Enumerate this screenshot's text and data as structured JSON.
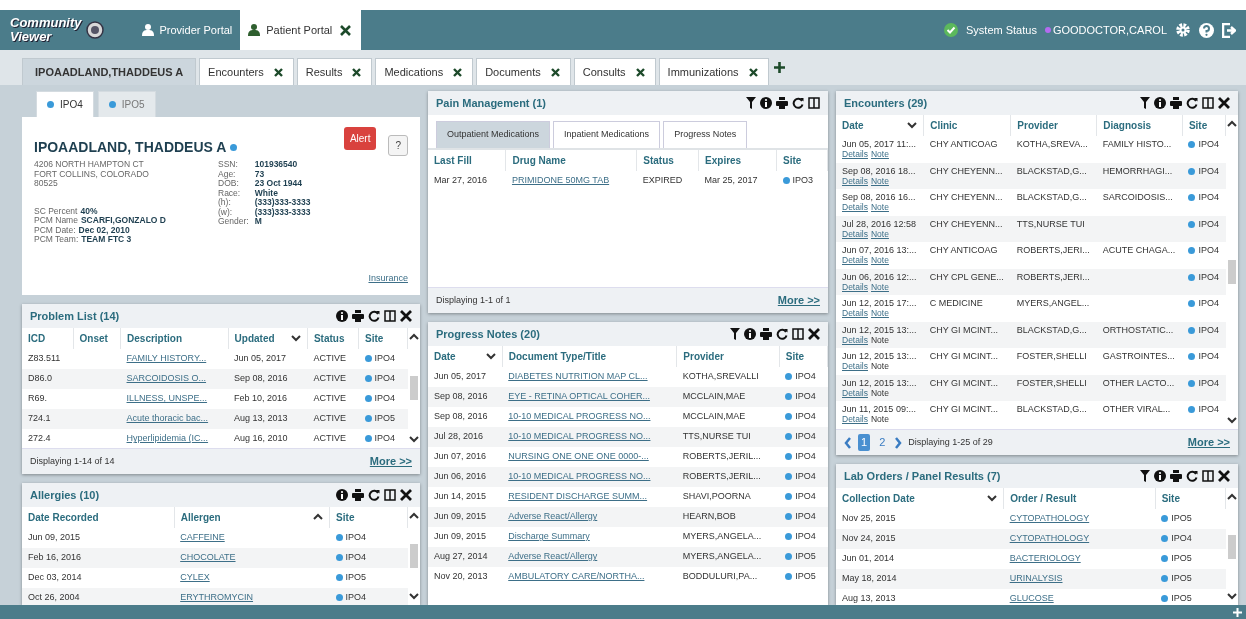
{
  "header": {
    "logo": {
      "line1": "Community",
      "line2": "Viewer"
    },
    "portal_tabs": [
      {
        "label": "Provider Portal",
        "selected": false,
        "closable": false
      },
      {
        "label": "Patient Portal",
        "selected": true,
        "closable": true
      }
    ],
    "system_status": "System Status",
    "user": {
      "name": "GOODOCTOR,CAROL",
      "color": "#b36bf0"
    }
  },
  "tabs": [
    {
      "label": "IPOAADLAND,THADDEUS A",
      "selected": true,
      "closable": false
    },
    {
      "label": "Encounters",
      "selected": false,
      "closable": true
    },
    {
      "label": "Results",
      "selected": false,
      "closable": true
    },
    {
      "label": "Medications",
      "selected": false,
      "closable": true
    },
    {
      "label": "Documents",
      "selected": false,
      "closable": true
    },
    {
      "label": "Consults",
      "selected": false,
      "closable": true
    },
    {
      "label": "Immunizations",
      "selected": false,
      "closable": true
    }
  ],
  "patient_card": {
    "site_tabs": [
      {
        "label": "IPO4",
        "selected": true
      },
      {
        "label": "IPO5",
        "selected": false
      }
    ],
    "name": "IPOAADLAND, THADDEUS A",
    "alert": "Alert",
    "help": "?",
    "address": [
      "4206 NORTH HAMPTON CT",
      "FORT COLLINS, COLORADO",
      "80525"
    ],
    "left_fields": [
      {
        "label": "SC Percent",
        "value": "40%"
      },
      {
        "label": "PCM Name",
        "value": "SCARFI,GONZALO D"
      },
      {
        "label": "PCM Date:",
        "value": "Dec 02, 2010"
      },
      {
        "label": "PCM Team:",
        "value": "TEAM FTC 3"
      }
    ],
    "right_fields": [
      {
        "label": "SSN:",
        "value": "101936540"
      },
      {
        "label": "Age:",
        "value": "73"
      },
      {
        "label": "DOB:",
        "value": "23 Oct 1944"
      },
      {
        "label": "Race:",
        "value": "White"
      },
      {
        "label": "(h):",
        "value": "(333)333-3333"
      },
      {
        "label": "(w):",
        "value": "(333)333-3333"
      },
      {
        "label": "Gender:",
        "value": "M"
      }
    ],
    "insurance_link": "Insurance"
  },
  "problem_list": {
    "title": "Problem List (14)",
    "tools": [
      {
        "kind": "info"
      },
      {
        "kind": "print"
      },
      {
        "kind": "refresh"
      },
      {
        "kind": "columns"
      },
      {
        "kind": "close"
      }
    ],
    "scrollable": true,
    "columns": [
      {
        "label": "ICD",
        "kind": "text"
      },
      {
        "label": "Onset",
        "kind": "text"
      },
      {
        "label": "Description",
        "kind": "link"
      },
      {
        "label": "Updated",
        "kind": "text",
        "sort_icon": {
          "kind": "down"
        }
      },
      {
        "label": "Status",
        "kind": "text"
      },
      {
        "label": "Site",
        "kind": "site"
      }
    ],
    "rows": [
      [
        "Z83.511",
        null,
        "FAMILY HISTORY...",
        "Jun 05, 2017",
        "ACTIVE",
        "IPO4"
      ],
      [
        "D86.0",
        null,
        "SARCOIDOSIS O...",
        "Sep 08, 2016",
        "ACTIVE",
        "IPO4"
      ],
      [
        "R69.",
        null,
        "ILLNESS, UNSPE...",
        "Feb 10, 2016",
        "ACTIVE",
        "IPO4"
      ],
      [
        "724.1",
        null,
        "Acute thoracic bac...",
        "Aug 13, 2013",
        "ACTIVE",
        "IPO5"
      ],
      [
        "272.4",
        null,
        "Hyperlipidemia (IC...",
        "Aug 16, 2010",
        "ACTIVE",
        "IPO4"
      ]
    ],
    "footer": {
      "text": "Displaying 1-14 of 14",
      "more": "More >>"
    }
  },
  "allergies": {
    "title": "Allergies (10)",
    "tools": [
      {
        "kind": "info"
      },
      {
        "kind": "print"
      },
      {
        "kind": "refresh"
      },
      {
        "kind": "columns"
      },
      {
        "kind": "close"
      }
    ],
    "scrollable": true,
    "columns": [
      {
        "label": "Date Recorded",
        "kind": "text"
      },
      {
        "label": "Allergen",
        "kind": "link",
        "sort_icon": {
          "kind": "up"
        }
      },
      {
        "label": "Site",
        "kind": "site"
      }
    ],
    "rows": [
      [
        "Jun 09, 2015",
        "CAFFEINE",
        "IPO4"
      ],
      [
        "Feb 16, 2016",
        "CHOCOLATE",
        "IPO4"
      ],
      [
        "Dec 03, 2014",
        "CYLEX",
        "IPO5"
      ],
      [
        "Oct 26, 2004",
        "ERYTHROMYCIN",
        "IPO4"
      ]
    ]
  },
  "pain_management": {
    "title": "Pain Management (1)",
    "tools": [
      {
        "kind": "filter"
      },
      {
        "kind": "info"
      },
      {
        "kind": "print"
      },
      {
        "kind": "refresh"
      },
      {
        "kind": "columns"
      }
    ],
    "tabs": [
      {
        "label": "Outpatient Medications",
        "selected": true
      },
      {
        "label": "Inpatient Medications",
        "selected": false
      },
      {
        "label": "Progress Notes",
        "selected": false
      }
    ],
    "columns": [
      {
        "label": "Last Fill",
        "kind": "text"
      },
      {
        "label": "Drug Name",
        "kind": "link"
      },
      {
        "label": "Status",
        "kind": "text"
      },
      {
        "label": "Expires",
        "kind": "text"
      },
      {
        "label": "Site",
        "kind": "site"
      }
    ],
    "rows": [
      [
        "Mar 27, 2016",
        "PRIMIDONE 50MG TAB",
        "EXPIRED",
        "Mar 25, 2017",
        "IPO3"
      ]
    ],
    "footer": {
      "text": "Displaying 1-1 of 1",
      "more": "More >>"
    }
  },
  "progress_notes": {
    "title": "Progress Notes (20)",
    "tools": [
      {
        "kind": "filter"
      },
      {
        "kind": "info"
      },
      {
        "kind": "print"
      },
      {
        "kind": "refresh"
      },
      {
        "kind": "columns"
      },
      {
        "kind": "close"
      }
    ],
    "columns": [
      {
        "label": "Date",
        "kind": "text",
        "sort_icon": {
          "kind": "down"
        }
      },
      {
        "label": "Document Type/Title",
        "kind": "link"
      },
      {
        "label": "Provider",
        "kind": "text"
      },
      {
        "label": "Site",
        "kind": "site"
      }
    ],
    "rows": [
      [
        "Jun 05, 2017",
        "DIABETES NUTRITION MAP CL...",
        "KOTHA,SREVALLI",
        "IPO4"
      ],
      [
        "Sep 08, 2016",
        "EYE - RETINA OPTICAL COHER...",
        "MCCLAIN,MAE",
        "IPO4"
      ],
      [
        "Sep 08, 2016",
        "10-10 MEDICAL PROGRESS NO...",
        "MCCLAIN,MAE",
        "IPO4"
      ],
      [
        "Jul 28, 2016",
        "10-10 MEDICAL PROGRESS NO...",
        "TTS,NURSE TUI",
        "IPO4"
      ],
      [
        "Jun 07, 2016",
        "NURSING ONE ONE ONE 0000-...",
        "ROBERTS,JERIL...",
        "IPO4"
      ],
      [
        "Jun 06, 2016",
        "10-10 MEDICAL PROGRESS NO...",
        "ROBERTS,JERIL...",
        "IPO4"
      ],
      [
        "Jun 14, 2015",
        "RESIDENT DISCHARGE SUMM...",
        "SHAVI,POORNA",
        "IPO4"
      ],
      [
        "Jun 09, 2015",
        "Adverse React/Allergy",
        "HEARN,BOB",
        "IPO4"
      ],
      [
        "Jun 09, 2015",
        "Discharge Summary",
        "MYERS,ANGELA...",
        "IPO4"
      ],
      [
        "Aug 27, 2014",
        "Adverse React/Allergy",
        "MYERS,ANGELA...",
        "IPO5"
      ],
      [
        "Nov 20, 2013",
        "AMBULATORY CARE/NORTHA...",
        "BODDULURI,PA...",
        "IPO5"
      ]
    ]
  },
  "encounters": {
    "title": "Encounters (29)",
    "tools": [
      {
        "kind": "filter"
      },
      {
        "kind": "info"
      },
      {
        "kind": "print"
      },
      {
        "kind": "refresh"
      },
      {
        "kind": "columns"
      },
      {
        "kind": "close"
      }
    ],
    "scrollable": true,
    "columns": [
      {
        "label": "Date",
        "kind": "encounter",
        "sort_icon": {
          "kind": "down"
        }
      },
      {
        "label": "Clinic",
        "kind": "text"
      },
      {
        "label": "Provider",
        "kind": "text"
      },
      {
        "label": "Diagnosis",
        "kind": "text"
      },
      {
        "label": "Site",
        "kind": "site"
      }
    ],
    "rows": [
      {
        "cells": [
          "Jun 05, 2017 11:...",
          "CHY ANTICOAG",
          "KOTHA,SREVA...",
          "FAMILY HISTO...",
          "IPO4"
        ],
        "links": [
          {
            "label": "Details",
            "linked": true
          },
          {
            "label": "Note",
            "linked": true
          }
        ]
      },
      {
        "cells": [
          "Sep 08, 2016 18...",
          "CHY CHEYENN...",
          "BLACKSTAD,G...",
          "HEMORRHAGI...",
          "IPO4"
        ],
        "links": [
          {
            "label": "Details",
            "linked": true
          },
          {
            "label": "Note",
            "linked": true
          }
        ]
      },
      {
        "cells": [
          "Sep 08, 2016 16...",
          "CHY CHEYENN...",
          "BLACKSTAD,G...",
          "SARCOIDOSIS...",
          "IPO4"
        ],
        "links": [
          {
            "label": "Details",
            "linked": true
          },
          {
            "label": "Note",
            "linked": true
          }
        ]
      },
      {
        "cells": [
          "Jul 28, 2016 12:58",
          "CHY CHEYENN...",
          "TTS,NURSE TUI",
          null,
          "IPO4"
        ],
        "links": [
          {
            "label": "Details",
            "linked": true
          },
          {
            "label": "Note",
            "linked": true
          }
        ]
      },
      {
        "cells": [
          "Jun 07, 2016 13:...",
          "CHY ANTICOAG",
          "ROBERTS,JERI...",
          "ACUTE CHAGA...",
          "IPO4"
        ],
        "links": [
          {
            "label": "Details",
            "linked": true
          },
          {
            "label": "Note",
            "linked": true
          }
        ]
      },
      {
        "cells": [
          "Jun 06, 2016 12:...",
          "CHY CPL GENE...",
          "ROBERTS,JERI...",
          null,
          "IPO4"
        ],
        "links": [
          {
            "label": "Details",
            "linked": true
          },
          {
            "label": "Note",
            "linked": true
          }
        ]
      },
      {
        "cells": [
          "Jun 12, 2015 17:...",
          "C MEDICINE",
          "MYERS,ANGEL...",
          null,
          "IPO4"
        ],
        "links": [
          {
            "label": "Details",
            "linked": true
          },
          {
            "label": "Note",
            "linked": true
          }
        ]
      },
      {
        "cells": [
          "Jun 12, 2015 13:...",
          "CHY GI MCINT...",
          "BLACKSTAD,G...",
          "ORTHOSTATIC...",
          "IPO4"
        ],
        "links": [
          {
            "label": "Details",
            "linked": true
          },
          {
            "label": "Note",
            "linked": false
          }
        ]
      },
      {
        "cells": [
          "Jun 12, 2015 13:...",
          "CHY GI MCINT...",
          "FOSTER,SHELLI",
          "GASTROINTES...",
          "IPO4"
        ],
        "links": [
          {
            "label": "Details",
            "linked": true
          },
          {
            "label": "Note",
            "linked": false
          }
        ]
      },
      {
        "cells": [
          "Jun 12, 2015 13:...",
          "CHY GI MCINT...",
          "FOSTER,SHELLI",
          "OTHER LACTO...",
          "IPO4"
        ],
        "links": [
          {
            "label": "Details",
            "linked": true
          },
          {
            "label": "Note",
            "linked": false
          }
        ]
      },
      {
        "cells": [
          "Jun 11, 2015 09:...",
          "CHY GI MCINT...",
          "BLACKSTAD,G...",
          "OTHER VIRAL...",
          "IPO4"
        ],
        "links": [
          {
            "label": "Details",
            "linked": true
          },
          {
            "label": "Note",
            "linked": false
          }
        ]
      }
    ],
    "footer": {
      "pages": [
        {
          "label": "1",
          "selected": true
        },
        {
          "label": "2",
          "selected": false
        }
      ],
      "text": "Displaying 1-25 of 29",
      "more": "More >>"
    }
  },
  "lab_orders": {
    "title": "Lab Orders / Panel Results (7)",
    "tools": [
      {
        "kind": "filter"
      },
      {
        "kind": "info"
      },
      {
        "kind": "print"
      },
      {
        "kind": "refresh"
      },
      {
        "kind": "columns"
      },
      {
        "kind": "close"
      }
    ],
    "scrollable": true,
    "columns": [
      {
        "label": "Collection Date",
        "kind": "text",
        "sort_icon": {
          "kind": "down"
        }
      },
      {
        "label": "Order / Result",
        "kind": "link"
      },
      {
        "label": "Site",
        "kind": "site"
      }
    ],
    "rows": [
      [
        "Nov 25, 2015",
        "CYTOPATHOLOGY",
        "IPO5"
      ],
      [
        "Nov 24, 2015",
        "CYTOPATHOLOGY",
        "IPO4"
      ],
      [
        "Jun 01, 2014",
        "BACTERIOLOGY",
        "IPO5"
      ],
      [
        "May 18, 2014",
        "URINALYSIS",
        "IPO5"
      ],
      [
        "Aug 13, 2013",
        "GLUCOSE",
        "IPO5"
      ]
    ]
  }
}
